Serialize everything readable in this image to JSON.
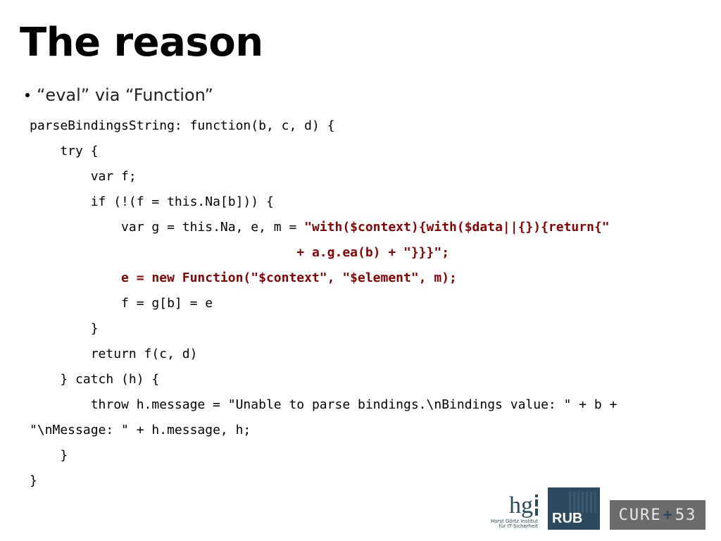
{
  "title": "The reason",
  "bullet": "“eval” via “Function”",
  "code": {
    "l1": "parseBindingsString: function(b, c, d) {",
    "l2": "    try {",
    "l3": "        var f;",
    "l4": "        if (!(f = this.Na[b])) {",
    "l5a": "            var g = this.Na, e, m = ",
    "l5b": "\"with($context){with($data||{}){return{\"",
    "l5c": "                                   + a.g.ea(b) + \"}}}\";",
    "l6": "            e = new Function(\"$context\", \"$element\", m);",
    "l7": "            f = g[b] = e",
    "l8": "        }",
    "l9": "        return f(c, d)",
    "l10": "    } catch (h) {",
    "l11": "        throw h.message = \"Unable to parse bindings.\\nBindings value: \" + b + ",
    "l12": "\"\\nMessage: \" + h.message, h;",
    "l13": "    }",
    "l14": "}"
  },
  "logos": {
    "hgi_h": "h",
    "hgi_g": "g",
    "hgi_sub1": "Horst Görtz Institut",
    "hgi_sub2": "für IT-Sicherheit",
    "rub": "RUB",
    "cure_left": "CURE",
    "cure_plus": "+",
    "cure_right": "53"
  }
}
